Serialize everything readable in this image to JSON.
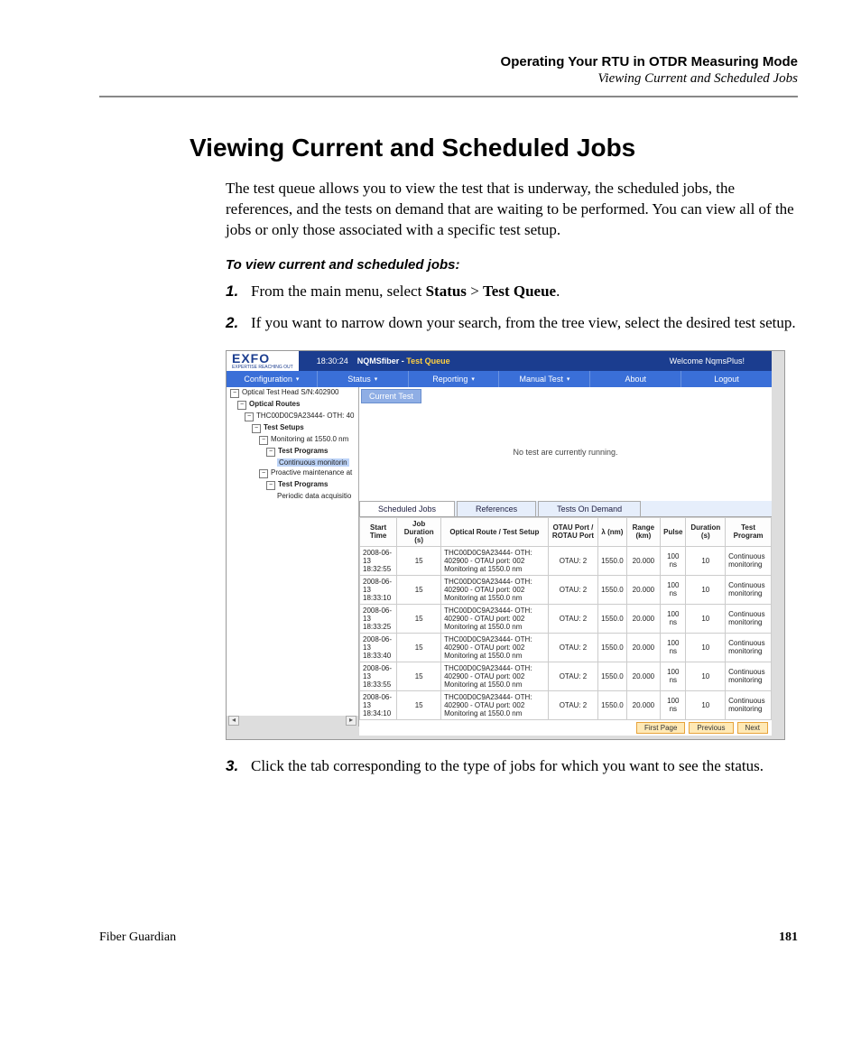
{
  "header": {
    "chapter": "Operating Your RTU in OTDR Measuring Mode",
    "section": "Viewing Current and Scheduled Jobs"
  },
  "title": "Viewing Current and Scheduled Jobs",
  "intro": "The test queue allows you to view the test that is underway, the scheduled jobs, the references, and the tests on demand that are waiting to be performed. You can view all of the jobs or only those associated with a specific test setup.",
  "procedure_title": "To view current and scheduled jobs:",
  "steps": {
    "s1_pre": "From the main menu, select ",
    "s1_b1": "Status",
    "s1_mid": " > ",
    "s1_b2": "Test Queue",
    "s1_post": ".",
    "s2": "If you want to narrow down your search, from the tree view, select the desired test setup.",
    "s3": "Click the tab corresponding to the type of jobs for which you want to see the status."
  },
  "shot": {
    "logo": "EXFO",
    "logo_sub": "EXPERTISE REACHING OUT",
    "time": "18:30:24",
    "crumb_a": "NQMSfiber",
    "crumb_sep": " - ",
    "crumb_b": "Test Queue",
    "welcome": "Welcome NqmsPlus!",
    "menu": [
      "Configuration",
      "Status",
      "Reporting",
      "Manual Test",
      "About",
      "Logout"
    ],
    "tree": {
      "n0": "Optical Test Head S/N:402900",
      "n1": "Optical Routes",
      "n2": "THC00D0C9A23444- OTH: 40",
      "n3": "Test Setups",
      "n4": "Monitoring at 1550.0 nm",
      "n5": "Test Programs",
      "n6": "Continuous monitorin",
      "n7": "Proactive maintenance at",
      "n8": "Test Programs",
      "n9": "Periodic data acquisitio"
    },
    "current_tab": "Current Test",
    "no_tests": "No test are currently running.",
    "tabs": [
      "Scheduled Jobs",
      "References",
      "Tests On Demand"
    ],
    "cols": [
      "Start Time",
      "Job Duration (s)",
      "Optical Route / Test Setup",
      "OTAU Port / ROTAU Port",
      "λ (nm)",
      "Range (km)",
      "Pulse",
      "Duration (s)",
      "Test Program"
    ],
    "route_cell": "THC00D0C9A23444- OTH: 402900 - OTAU port: 002\nMonitoring at 1550.0 nm",
    "rows": [
      {
        "t": "2008-06-13 18:32:55",
        "d": "15",
        "p": "OTAU: 2",
        "l": "1550.0",
        "r": "20.000",
        "pu": "100 ns",
        "du": "10",
        "tp": "Continuous monitoring"
      },
      {
        "t": "2008-06-13 18:33:10",
        "d": "15",
        "p": "OTAU: 2",
        "l": "1550.0",
        "r": "20.000",
        "pu": "100 ns",
        "du": "10",
        "tp": "Continuous monitoring"
      },
      {
        "t": "2008-06-13 18:33:25",
        "d": "15",
        "p": "OTAU: 2",
        "l": "1550.0",
        "r": "20.000",
        "pu": "100 ns",
        "du": "10",
        "tp": "Continuous monitoring"
      },
      {
        "t": "2008-06-13 18:33:40",
        "d": "15",
        "p": "OTAU: 2",
        "l": "1550.0",
        "r": "20.000",
        "pu": "100 ns",
        "du": "10",
        "tp": "Continuous monitoring"
      },
      {
        "t": "2008-06-13 18:33:55",
        "d": "15",
        "p": "OTAU: 2",
        "l": "1550.0",
        "r": "20.000",
        "pu": "100 ns",
        "du": "10",
        "tp": "Continuous monitoring"
      },
      {
        "t": "2008-06-13 18:34:10",
        "d": "15",
        "p": "OTAU: 2",
        "l": "1550.0",
        "r": "20.000",
        "pu": "100 ns",
        "du": "10",
        "tp": "Continuous monitoring"
      }
    ],
    "pager": [
      "First Page",
      "Previous",
      "Next"
    ]
  },
  "footer": {
    "product": "Fiber Guardian",
    "page": "181"
  }
}
